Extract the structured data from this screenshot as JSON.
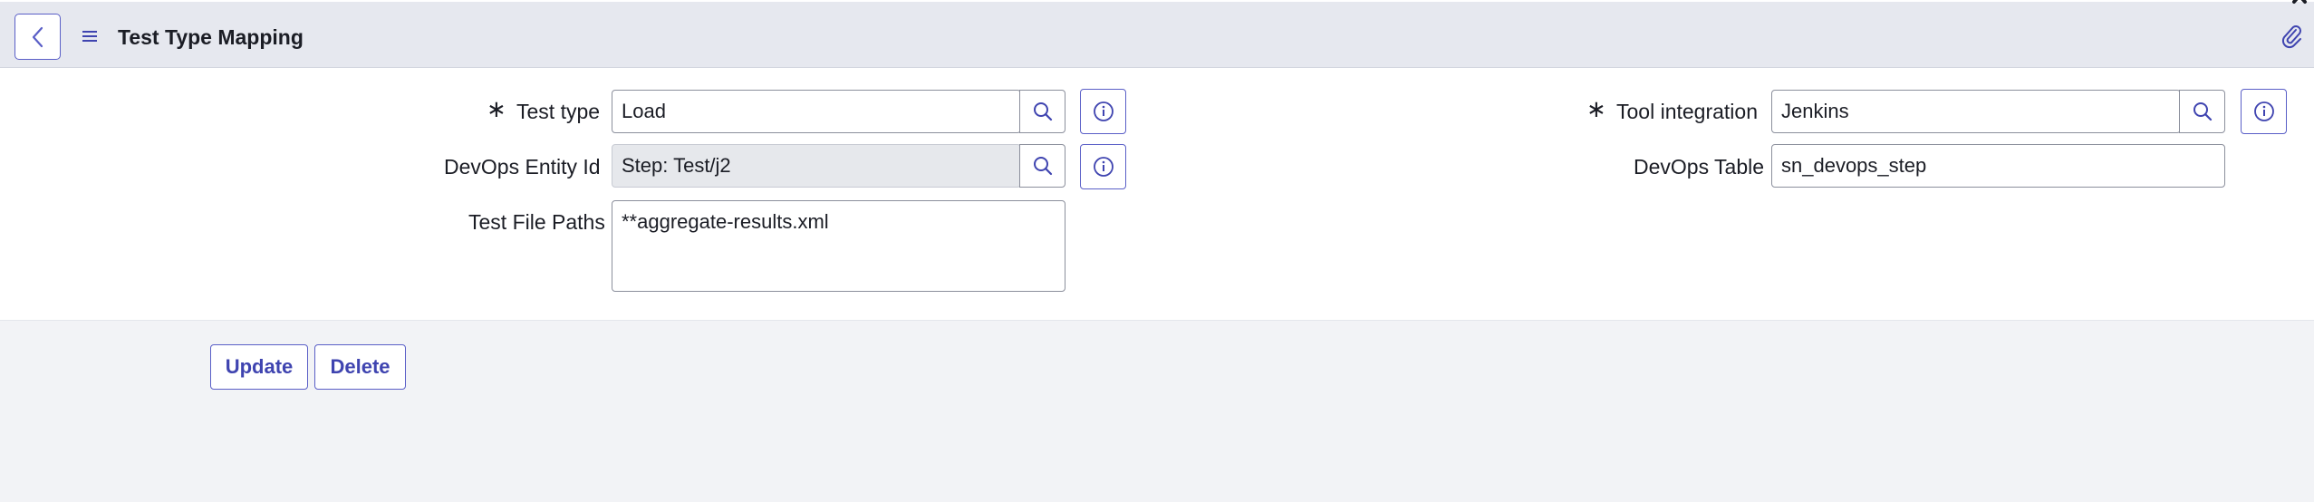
{
  "header": {
    "title": "Test Type Mapping"
  },
  "form": {
    "required_mark": "∗",
    "test_type": {
      "label": "Test type",
      "value": "Load"
    },
    "devops_entity_id": {
      "label": "DevOps Entity Id",
      "value": "Step: Test/j2"
    },
    "test_file_paths": {
      "label": "Test File Paths",
      "value": "**aggregate-results.xml"
    },
    "tool_integration": {
      "label": "Tool integration",
      "value": "Jenkins"
    },
    "devops_table": {
      "label": "DevOps Table",
      "value": "sn_devops_step"
    }
  },
  "actions": {
    "update_label": "Update",
    "delete_label": "Delete"
  },
  "icons": {
    "back": "chevron-left-icon",
    "menu": "hamburger-menu-icon",
    "attach": "paperclip-icon",
    "search": "search-icon",
    "info": "info-icon"
  },
  "colors": {
    "accent": "#5a5fc7",
    "header_bg": "#e6e8ef",
    "footer_bg": "#f2f3f6",
    "readonly_bg": "#e6e8ec"
  }
}
